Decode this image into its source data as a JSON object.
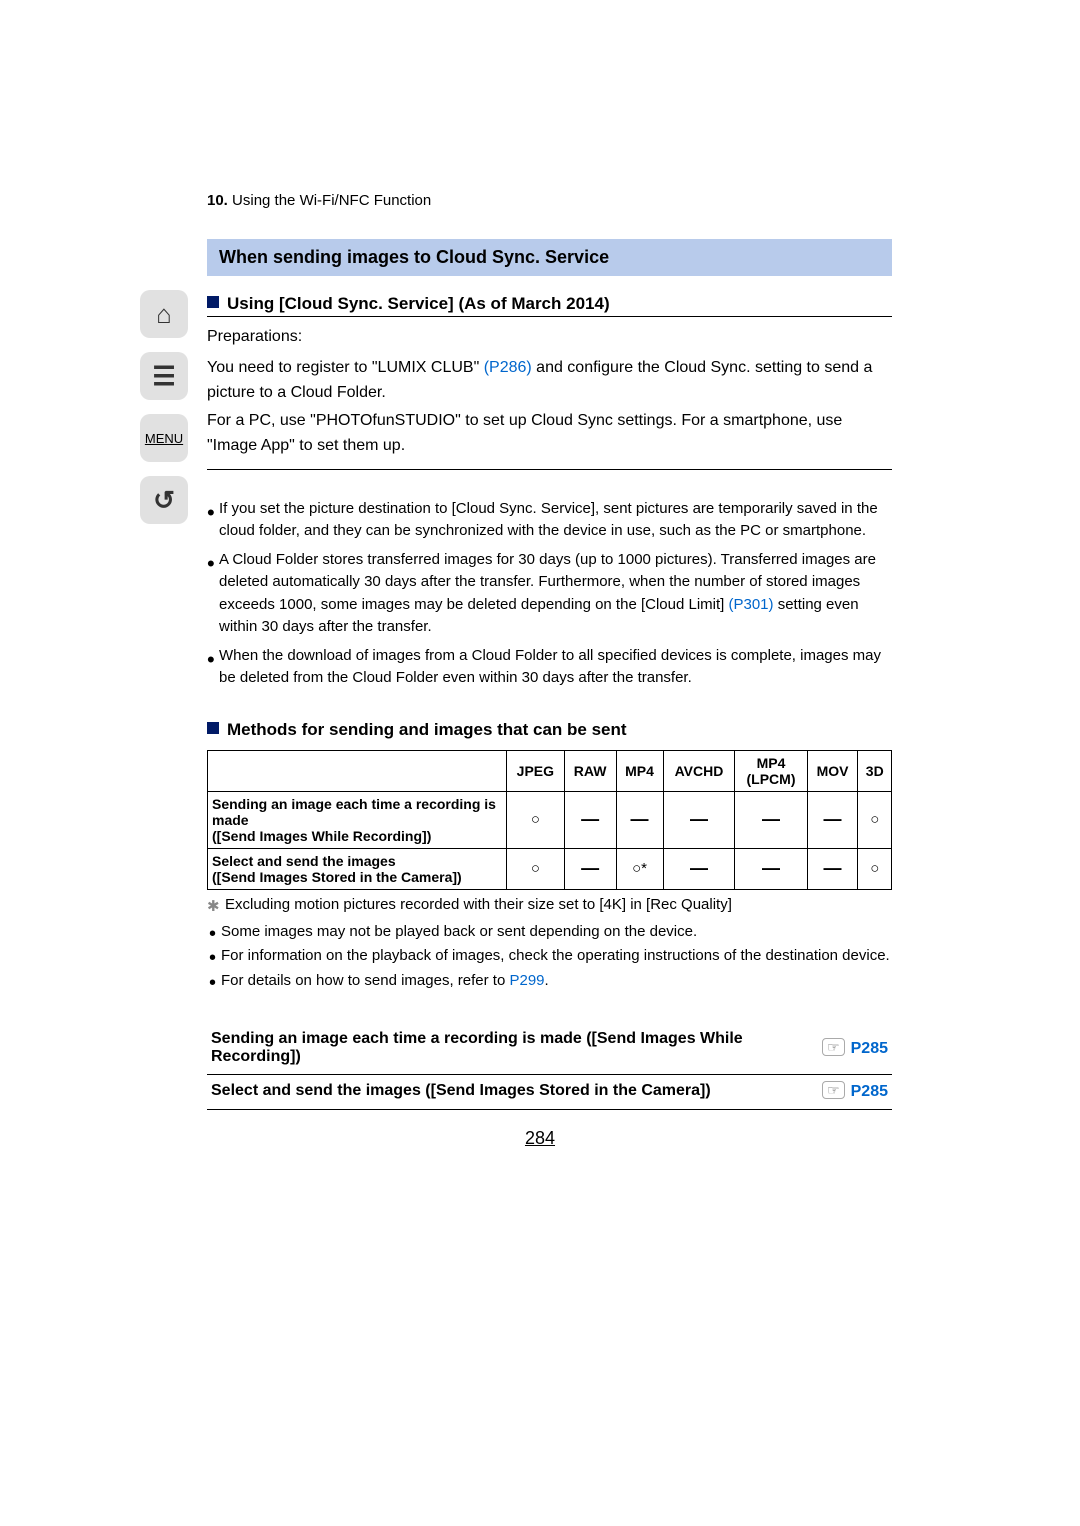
{
  "nav": {
    "home_icon": "⌂",
    "toc_icon": "☰",
    "menu_label": "MENU",
    "back_icon": "↺"
  },
  "crumb": {
    "num": "10.",
    "title": "Using the Wi-Fi/NFC Function"
  },
  "heading": "When sending images to Cloud Sync. Service",
  "sub1": "Using [Cloud Sync. Service] (As of March 2014)",
  "prep": {
    "label": "Preparations:",
    "intro1a": "You need to register to \"LUMIX CLUB\" ",
    "intro1_link": "(P286)",
    "intro1b": " and configure the Cloud Sync. setting to send a picture to a Cloud Folder.",
    "intro2": "For a PC, use \"PHOTOfunSTUDIO\" to set up Cloud Sync settings. For a smartphone, use \"Image App\" to set them up."
  },
  "notes": [
    "If you set the picture destination to [Cloud Sync. Service], sent pictures are temporarily saved in the cloud folder, and they can be synchronized with the device in use, such as the PC or smartphone.",
    "A Cloud Folder stores transferred images for 30 days (up to 1000 pictures). Transferred images are deleted automatically 30 days after the transfer. Furthermore, when the number of stored images exceeds 1000, some images may be deleted depending on the [Cloud Limit] ",
    "When the download of images from a Cloud Folder to all specified devices is complete, images may be deleted from the Cloud Folder even within 30 days after the transfer."
  ],
  "note2_link": "(P301)",
  "note2_tail": " setting even within 30 days after the transfer.",
  "sub2": "Methods for sending and images that can be sent",
  "table": {
    "headers": [
      "JPEG",
      "RAW",
      "MP4",
      "AVCHD",
      "MP4\n(LPCM)",
      "MOV",
      "3D"
    ],
    "rows": [
      {
        "label": "Sending an image each time a recording is made\n([Send Images While Recording])",
        "cells": [
          "○",
          "—",
          "—",
          "—",
          "—",
          "—",
          "○"
        ]
      },
      {
        "label": "Select and send the images\n([Send Images Stored in the Camera])",
        "cells": [
          "○",
          "—",
          "○*",
          "—",
          "—",
          "—",
          "○"
        ]
      }
    ]
  },
  "star_note": "Excluding motion pictures recorded with their size set to [4K] in [Rec Quality]",
  "tablenotes": [
    "Some images may not be played back or sent depending on the device.",
    "For information on the playback of images, check the operating instructions of the destination device.",
    "For details on how to send images, refer to "
  ],
  "tablenote3_link": "P299",
  "jumps": [
    {
      "text": "Sending an image each time a recording is made ([Send Images While Recording])",
      "ref": "P285"
    },
    {
      "text": "Select and send the images ([Send Images Stored in the Camera])",
      "ref": "P285"
    }
  ],
  "page_number": "284"
}
